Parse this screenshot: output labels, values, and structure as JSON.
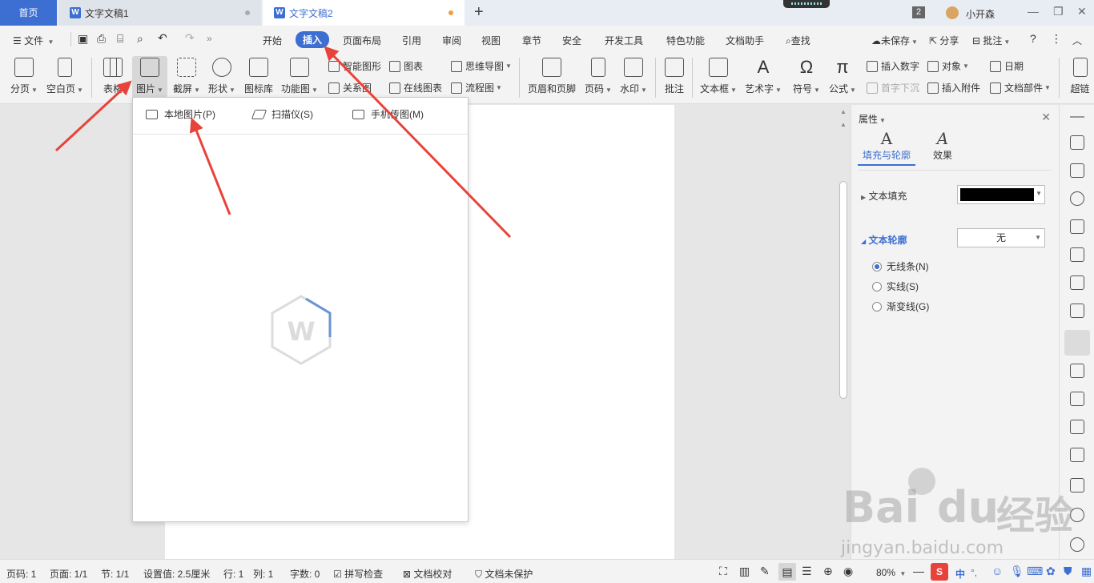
{
  "titlebar": {
    "home_tab": "首页",
    "tabs": [
      "文字文稿1",
      "文字文稿2"
    ],
    "tab_icon": "W",
    "window_count": "2",
    "user_name": "小开森"
  },
  "menu": {
    "file": "文件",
    "items": [
      "开始",
      "插入",
      "页面布局",
      "引用",
      "审阅",
      "视图",
      "章节",
      "安全",
      "开发工具",
      "特色功能",
      "文档助手",
      "查找"
    ],
    "unsaved": "未保存",
    "share": "分享",
    "comment": "批注",
    "help": "?"
  },
  "ribbon": {
    "page_break": "分页",
    "blank_page": "空白页",
    "table": "表格",
    "picture": "图片",
    "screenshot": "截屏",
    "shape": "形状",
    "icon_lib": "图标库",
    "func_chart": "功能图",
    "smart_shape": "智能图形",
    "relation_chart": "关系图",
    "chart": "图表",
    "online_chart": "在线图表",
    "mindmap": "思维导图",
    "flowchart": "流程图",
    "header_footer": "页眉和页脚",
    "page_num": "页码",
    "watermark": "水印",
    "comment": "批注",
    "textbox": "文本框",
    "wordart": "艺术字",
    "symbol": "符号",
    "formula": "公式",
    "insert_number": "插入数字",
    "object": "对象",
    "date": "日期",
    "drop_cap": "首字下沉",
    "attachment": "插入附件",
    "doc_parts": "文档部件",
    "hyperlink": "超链"
  },
  "picture_menu": {
    "local": "本地图片(P)",
    "scanner": "扫描仪(S)",
    "phone": "手机传图(M)"
  },
  "panel": {
    "title": "属性",
    "tab_fill": "填充与轮廓",
    "tab_effect": "效果",
    "tab_glyph": "A",
    "text_fill": "文本填充",
    "text_fill_color": "#000000",
    "text_outline": "文本轮廓",
    "outline_value": "无",
    "options": [
      "无线条(N)",
      "实线(S)",
      "渐变线(G)"
    ],
    "selected_option": 0
  },
  "status": {
    "page_code": "页码: 1",
    "page": "页面: 1/1",
    "section": "节: 1/1",
    "setting": "设置值: 2.5厘米",
    "row": "行: 1",
    "col": "列: 1",
    "word_count": "字数: 0",
    "spell_check": "拼写检查",
    "doc_proof": "文档校对",
    "doc_unprotected": "文档未保护",
    "zoom": "80%",
    "ime": "中"
  },
  "watermark": {
    "brand": "Bai",
    "brand2": "du",
    "cn": "经验",
    "url": "jingyan.baidu.com"
  },
  "colors": {
    "accent": "#3d6ed1",
    "arrow": "#e8433a"
  }
}
